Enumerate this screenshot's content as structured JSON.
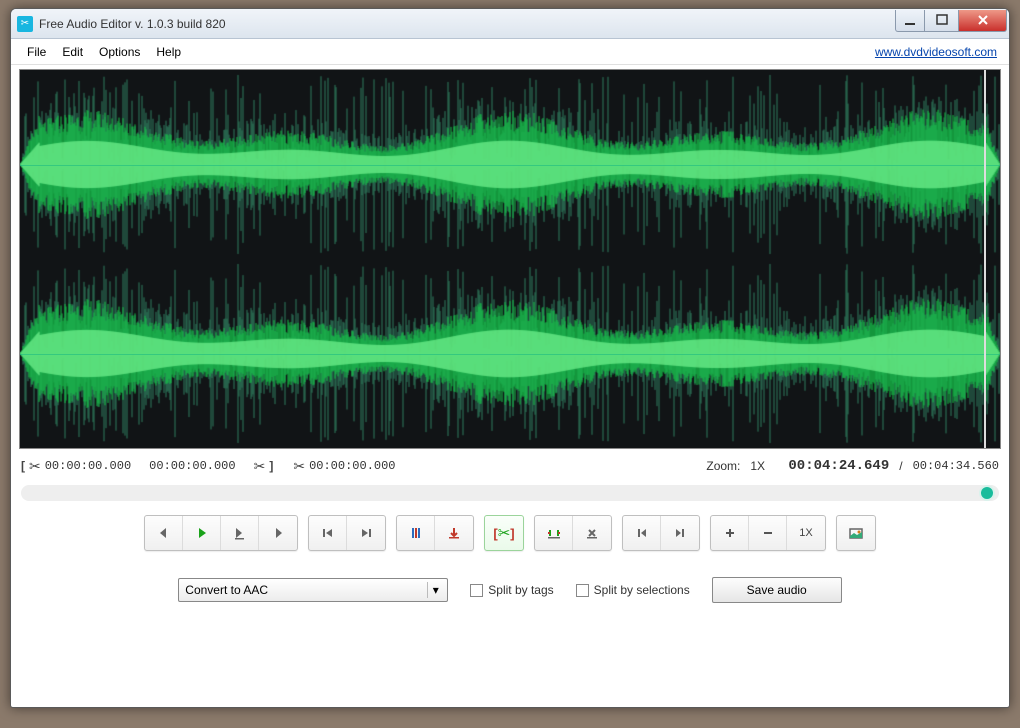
{
  "window": {
    "title": "Free Audio Editor v. 1.0.3 build 820"
  },
  "menu": {
    "file": "File",
    "edit": "Edit",
    "options": "Options",
    "help": "Help",
    "site_link": "www.dvdvideosoft.com"
  },
  "selection": {
    "start": "00:00:00.000",
    "end": "00:00:00.000",
    "cut_at": "00:00:00.000"
  },
  "transport": {
    "zoom_label": "Zoom:",
    "zoom_value": "1X",
    "current_position": "00:04:24.649",
    "separator": "/",
    "total_duration": "00:04:34.560"
  },
  "buttons": {
    "zoom_level_label": "1X"
  },
  "footer": {
    "convert_label": "Convert to AAC",
    "split_tags": "Split by tags",
    "split_selections": "Split by selections",
    "save": "Save audio"
  }
}
